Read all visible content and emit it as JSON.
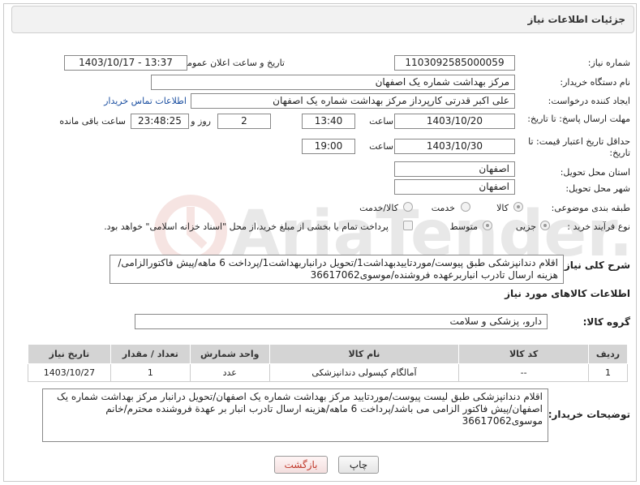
{
  "page": {
    "title": "جزئیات اطلاعات نیاز"
  },
  "fields": {
    "need_number_label": "شماره نیاز:",
    "need_number": "1103092585000059",
    "announce_label": "تاریخ و ساعت اعلان عمومی:",
    "announce_value": "1403/10/17 - 13:37",
    "buyer_org_label": "نام دستگاه خریدار:",
    "buyer_org": "مرکز بهداشت شماره یک اصفهان",
    "creator_label": "ایجاد کننده درخواست:",
    "creator": "علی اکبر قدرتی کارپرداز مرکز بهداشت شماره یک اصفهان",
    "contact_link": "اطلاعات تماس خریدار",
    "deadline_label": "مهلت ارسال پاسخ: تا تاریخ:",
    "deadline_date": "1403/10/20",
    "time_label": "ساعت",
    "deadline_time": "13:40",
    "days_value": "2",
    "days_label": "روز و",
    "remaining_time": "23:48:25",
    "remaining_label": "ساعت باقی مانده",
    "validity_label": "حداقل تاریخ اعتبار قیمت: تا تاریخ:",
    "validity_date": "1403/10/30",
    "validity_time": "19:00",
    "province_label": "استان محل تحویل:",
    "province": "اصفهان",
    "city_label": "شهر محل تحویل:",
    "city": "اصفهان",
    "category_label": "طبقه بندی موضوعی:",
    "cat_goods": "کالا",
    "cat_service": "خدمت",
    "cat_goods_service": "کالا/خدمت",
    "process_label": "نوع فرآیند خرید :",
    "proc_partial": "جزیی",
    "proc_medium": "متوسط",
    "proc_note": "پرداخت تمام یا بخشی از مبلغ خرید،از محل \"اسناد خزانه اسلامی\" خواهد بود."
  },
  "description": {
    "label": "شرح کلی نیاز:",
    "text": "اقلام دندانپزشکی طبق پیوست/موردتاییدبهداشت1/تحویل درانباربهداشت1/پرداخت 6 ماهه/پیش فاکتورالزامی/هزینه ارسال تادرب انباربرعهده فروشنده/موسوی36617062"
  },
  "goods": {
    "section_title": "اطلاعات کالاهای مورد نیاز",
    "group_label": "گروه کالا:",
    "group_value": "دارو، پزشکی و سلامت",
    "headers": [
      "ردیف",
      "کد کالا",
      "نام کالا",
      "واحد شمارش",
      "تعداد / مقدار",
      "تاریخ نیاز"
    ],
    "rows": [
      {
        "row": "1",
        "code": "--",
        "name": "آمالگام کپسولی دندانپزشکی",
        "unit": "عدد",
        "qty": "1",
        "date": "1403/10/27"
      }
    ]
  },
  "buyer_notes": {
    "label": "توضیحات خریدار:",
    "text": "اقلام دندانپزشکی طبق لیست پیوست/موردتایید مرکز بهداشت شماره یک اصفهان/تحویل درانبار مرکز بهداشت شماره یک اصفهان/پیش فاکتور الزامی می باشد/پرداخت 6 ماهه/هزینه ارسال تادرب انبار بر عهدة فروشنده محترم/خانم موسوی36617062"
  },
  "buttons": {
    "print": "چاپ",
    "back": "بازگشت"
  },
  "watermark_text": "AriaTender.neT"
}
